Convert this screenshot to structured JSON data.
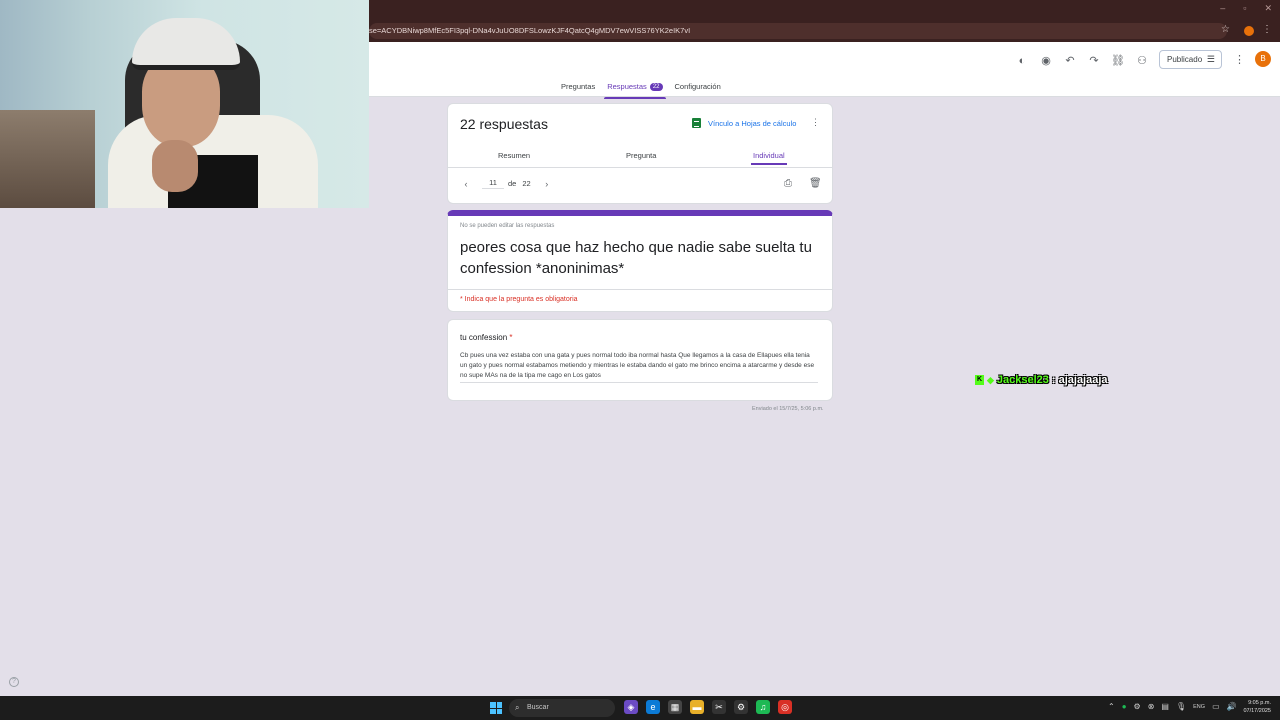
{
  "browser": {
    "url": "se=ACYDBNiwp8MfEc5FI3pql-DNa4vJuUO8DFSLowzKJF4QatcQ4gMDV7ewVISS76YK2eIK7vI",
    "win_min": "–",
    "win_max": "▫",
    "win_close": "✕"
  },
  "header": {
    "publish_label": "Publicado",
    "avatar_letter": "B",
    "tabs": [
      {
        "label": "Preguntas"
      },
      {
        "label": "Respuestas",
        "badge": "22"
      },
      {
        "label": "Configuración"
      }
    ]
  },
  "summary": {
    "title": "22 respuestas",
    "sheets_link": "Vínculo a Hojas de cálculo",
    "subtabs": [
      "Resumen",
      "Pregunta",
      "Individual"
    ],
    "current": "11",
    "of_label": "de",
    "total": "22"
  },
  "form": {
    "no_edit_note": "No se pueden editar las respuestas",
    "title": "peores cosa que haz hecho que nadie sabe suelta tu confession *anoninimas*",
    "required_note": "* Indica que la pregunta es obligatoria"
  },
  "question": {
    "label": "tu confession",
    "required_mark": "*",
    "answer": "Cb pues una vez estaba con una gata y pues normal todo iba normal hasta Que llegamos a la casa de Ellapues ella tenia un gato y pues normal estabamos metiendo y mientras le estaba dando el gato me brinco encima a atarcarme y desde ese no supe MAs na de la tipa me cago en Los gatos",
    "sent_on": "Enviado el 15/7/25, 5:06 p.m."
  },
  "chat": {
    "kick_badge": "K",
    "username": "Jacksel23",
    "separator": ":",
    "message": "ajajajaaja"
  },
  "taskbar": {
    "search_placeholder": "Buscar",
    "lang": "ENG",
    "time": "9:05 p.m.",
    "date": "07/17/2025"
  },
  "colors": {
    "accent": "#673ab7",
    "link": "#1a73e8",
    "required": "#d93025",
    "chrome_bg": "#3a2120",
    "page_bg": "#e3dfe9"
  }
}
